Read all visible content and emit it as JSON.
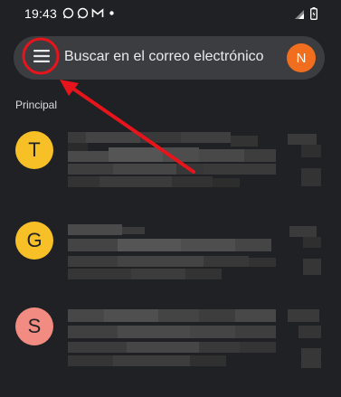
{
  "status_bar": {
    "time": "19:43",
    "icons": [
      "whatsapp-icon",
      "whatsapp-icon",
      "gmail-icon",
      "dot-icon"
    ],
    "right_icons": [
      "signal-icon",
      "battery-icon"
    ]
  },
  "search": {
    "placeholder": "Buscar en el correo electrónico",
    "account_initial": "N",
    "account_color": "#f16e1e"
  },
  "section": {
    "label": "Principal"
  },
  "emails": [
    {
      "initial": "T",
      "color": "#f6c026"
    },
    {
      "initial": "G",
      "color": "#f6c026"
    },
    {
      "initial": "S",
      "color": "#f28b82"
    }
  ],
  "annotation": {
    "color": "#e8141c"
  }
}
